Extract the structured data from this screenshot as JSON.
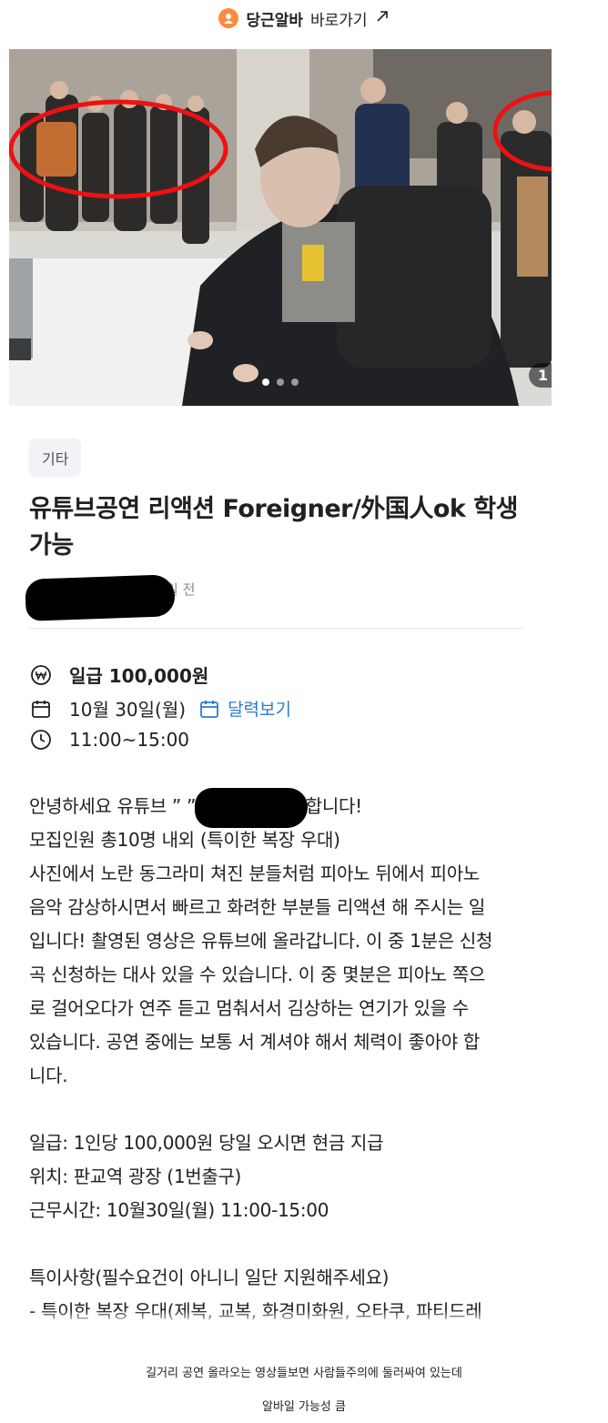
{
  "header": {
    "brand": "당근알바",
    "goto_label": "바로가기",
    "arrow_icon": "external-arrow-icon",
    "logo_color": "#ff8a3d"
  },
  "photo": {
    "counter": "1",
    "dot_count": 3,
    "active_dot": 1
  },
  "post": {
    "category": "기타",
    "title": "유튜브공연 리액션 Foreigner/外国人ok 학생가능",
    "time_ago": "일 전",
    "pay_label": "일급 100,000원",
    "date": "10월 30일(월)",
    "calendar_link": "달력보기",
    "hours": "11:00~15:00",
    "link_color": "#2a7bd6"
  },
  "body": {
    "lines": [
      "안녕하세요 유튜브 ”                        ” 보조출연 모집합니다!",
      "모집인원 총10명 내외 (특이한 복장 우대)",
      "사진에서 노란 동그라미 쳐진 분들처럼 피아노 뒤에서 피아노",
      "음악 감상하시면서 빠르고 화려한 부분들 리액션 해 주시는 일",
      "입니다! 촬영된 영상은 유튜브에 올라갑니다. 이 중 1분은 신청",
      "곡 신청하는 대사 있을 수 있습니다. 이 중 몇분은 피아노 쪽으",
      "로 걸어오다가 연주 듣고 멈춰서서 김상하는 연기가 있을 수",
      "있습니다. 공연 중에는 보통 서 계셔야 해서 체력이 좋아야 합",
      "니다.",
      "",
      "일급: 1인당 100,000원 당일 오시면 현금 지급",
      "위치: 판교역 광장 (1번출구)",
      "근무시간: 10월30일(월) 11:00-15:00",
      "",
      "특이사항(필수요건이 아니니 일단 지원해주세요)",
      "- 특이한 복장 우대(제복, 교복, 화경미화원, 오타쿠, 파티드레"
    ]
  },
  "caption": {
    "line1": "길거리 공연 올라오는 영상들보면 사람들주의에 둘러싸여 있는데",
    "line2": "알바일 가능성 큼"
  }
}
